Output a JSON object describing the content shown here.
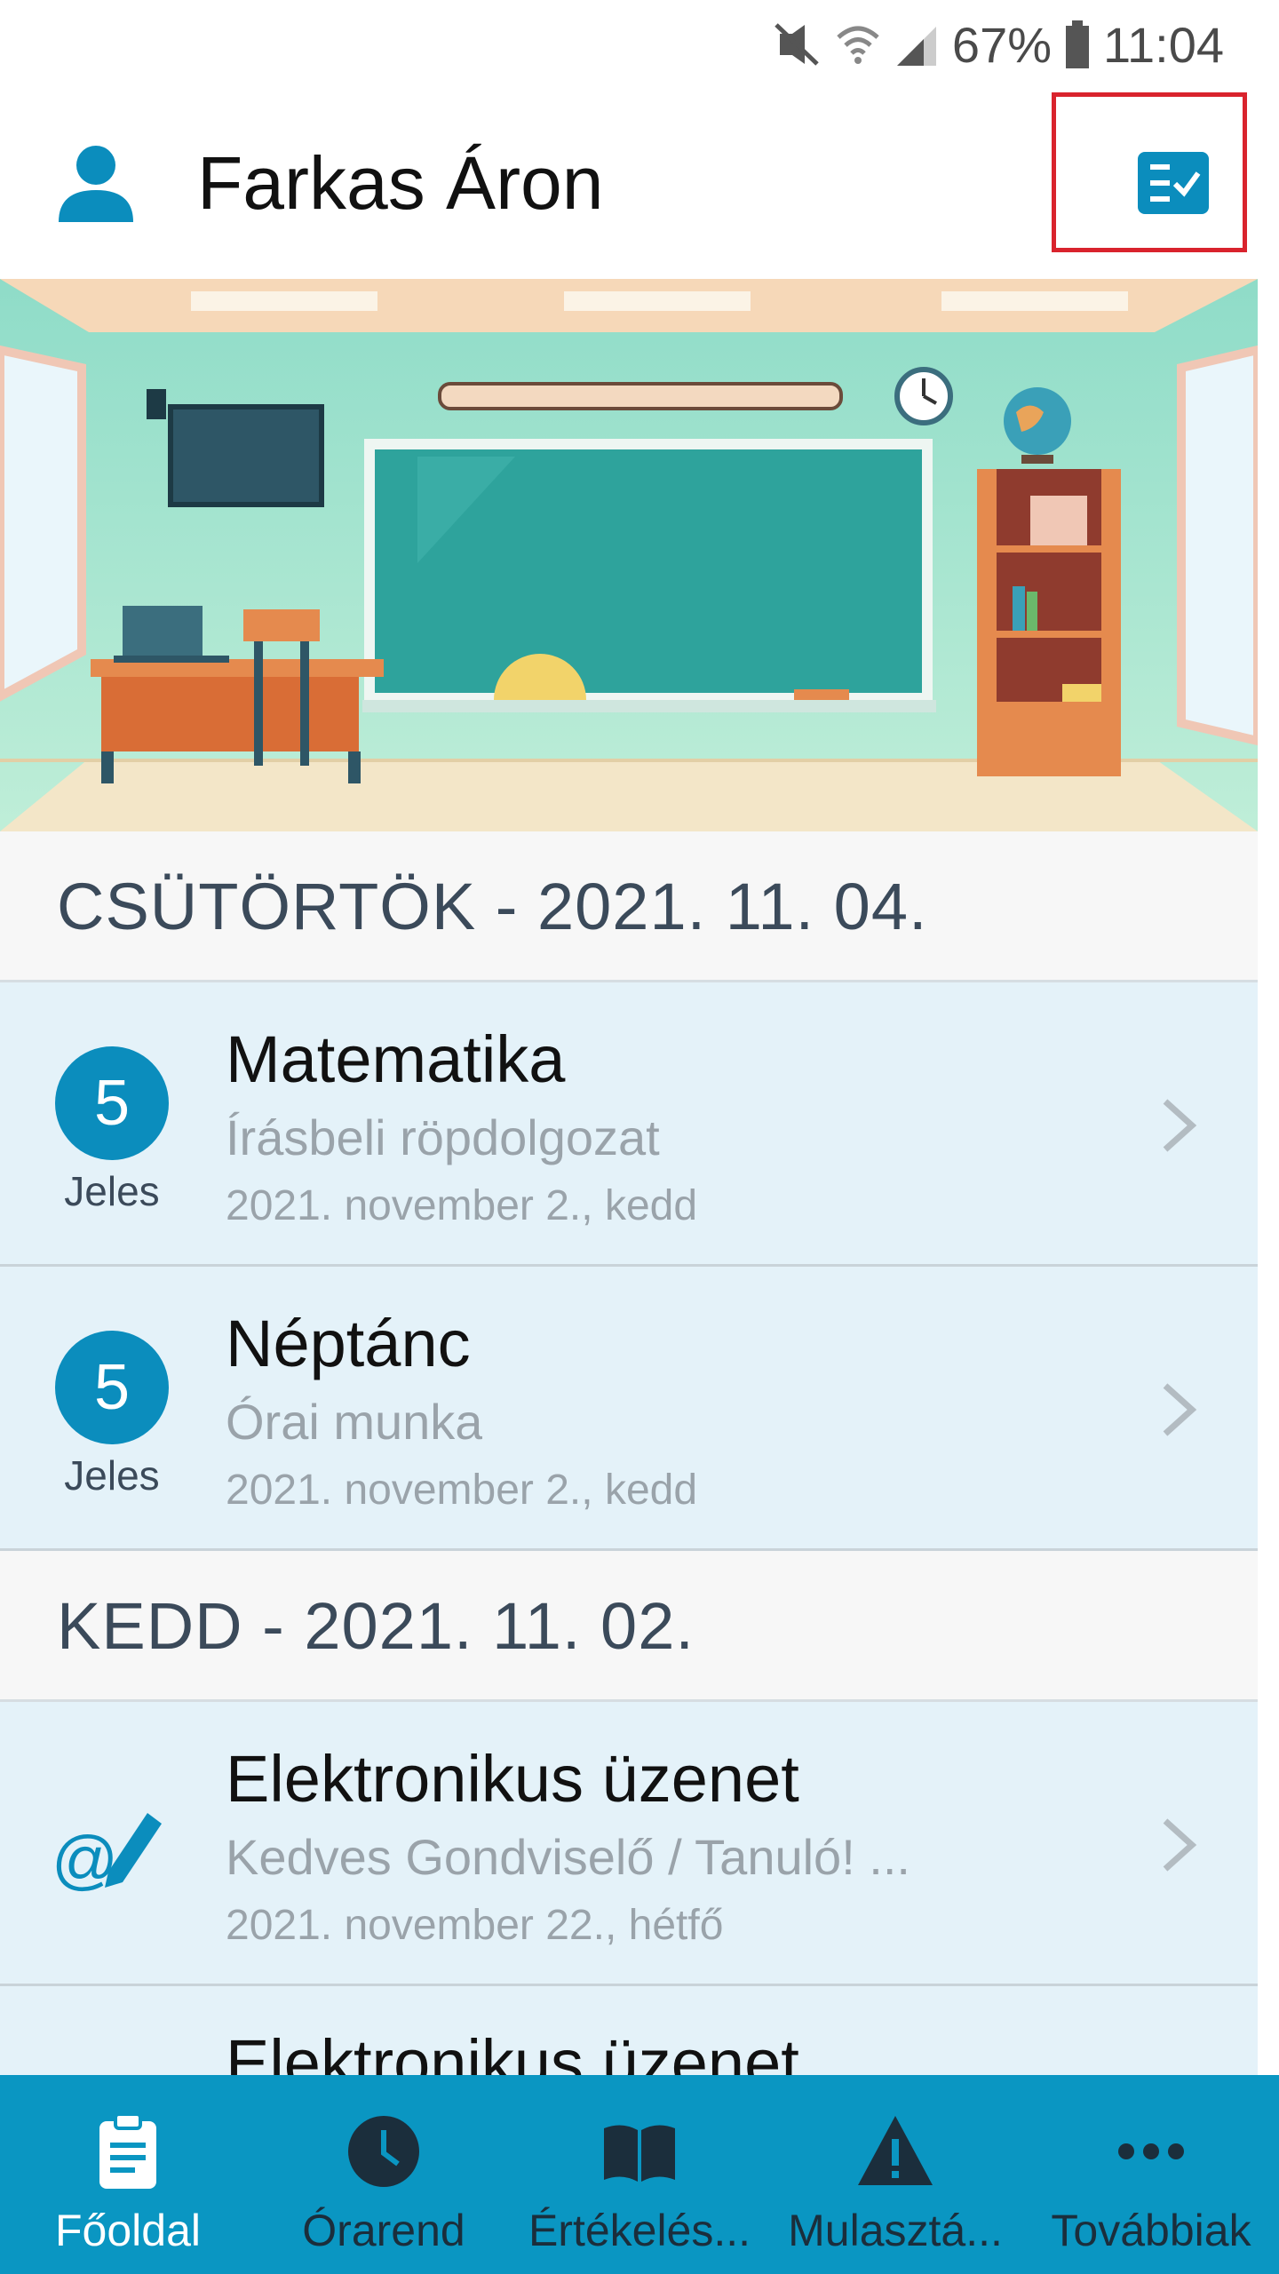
{
  "status_bar": {
    "battery": "67%",
    "time": "11:04",
    "icons": [
      "mute-vibrate-icon",
      "wifi-icon",
      "signal-icon",
      "battery-icon"
    ]
  },
  "header": {
    "title": "Farkas Áron",
    "icons": [
      "user-avatar-icon",
      "checklist-icon"
    ],
    "accent": "#0b8dbd",
    "highlight_color": "#d9232d"
  },
  "feed": {
    "day1": {
      "label": "CSÜTÖRTÖK - 2021. 11. 04.",
      "items": [
        {
          "grade": "5",
          "grade_text": "Jeles",
          "title": "Matematika",
          "subtitle": "Írásbeli röpdolgozat",
          "date": "2021. november 2., kedd"
        },
        {
          "grade": "5",
          "grade_text": "Jeles",
          "title": "Néptánc",
          "subtitle": "Órai munka",
          "date": "2021. november 2., kedd"
        }
      ]
    },
    "day2": {
      "label": "KEDD - 2021. 11. 02.",
      "items": [
        {
          "icon": "email-pencil-icon",
          "title": "Elektronikus üzenet",
          "subtitle": "Kedves Gondviselő / Tanuló!  ...",
          "date": "2021. november 22., hétfő"
        },
        {
          "title": "Elektronikus üzenet"
        }
      ]
    }
  },
  "bottom_nav": {
    "background": "#0a96c2",
    "items": [
      {
        "label": "Főoldal",
        "icon": "clipboard-icon",
        "active": true
      },
      {
        "label": "Órarend",
        "icon": "clock-icon"
      },
      {
        "label": "Értékelés...",
        "icon": "book-icon"
      },
      {
        "label": "Mulasztá...",
        "icon": "warning-icon"
      },
      {
        "label": "Továbbiak",
        "icon": "more-dots-icon"
      }
    ]
  }
}
